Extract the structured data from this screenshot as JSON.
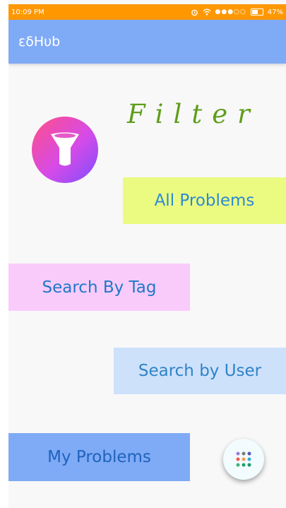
{
  "status_bar": {
    "time": "10:09 PM",
    "battery": "47%"
  },
  "app_bar": {
    "title": "εδHυb"
  },
  "content": {
    "title": "Filter"
  },
  "buttons": {
    "all_problems": "All Problems",
    "search_by_tag": "Search By Tag",
    "search_by_user": "Search by User",
    "my_problems": "My Problems"
  },
  "colors": {
    "status_bar": "#ff9800",
    "app_bar": "#7faaf6",
    "all_problems_bg": "#ebfb81",
    "search_by_tag_bg": "#f9cbfb",
    "search_by_user_bg": "#cde1fb",
    "my_problems_bg": "#7faaf6"
  },
  "icons": {
    "filter": "funnel-icon",
    "fab": "grid-dots-icon"
  }
}
